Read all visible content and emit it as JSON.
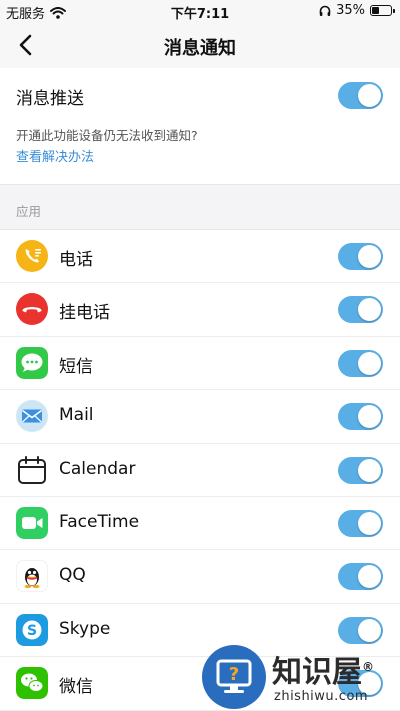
{
  "status_bar": {
    "carrier": "无服务",
    "time": "下午7:11",
    "battery": "35%",
    "battery_level": 0.35,
    "icons": [
      "wifi-icon",
      "headphones-icon",
      "battery-icon"
    ]
  },
  "nav": {
    "title": "消息通知",
    "back_icon": "chevron-left-icon"
  },
  "push": {
    "label": "消息推送",
    "enabled": true,
    "hint": "开通此功能设备仍无法收到通知?",
    "link": "查看解决办法"
  },
  "apps_section": {
    "header": "应用",
    "items": [
      {
        "label": "电话",
        "icon": "phone-icon",
        "enabled": true
      },
      {
        "label": "挂电话",
        "icon": "hang-up-icon",
        "enabled": true
      },
      {
        "label": "短信",
        "icon": "messages-icon",
        "enabled": true
      },
      {
        "label": "Mail",
        "icon": "mail-icon",
        "enabled": true
      },
      {
        "label": "Calendar",
        "icon": "calendar-icon",
        "enabled": true
      },
      {
        "label": "FaceTime",
        "icon": "facetime-icon",
        "enabled": true
      },
      {
        "label": "QQ",
        "icon": "qq-icon",
        "enabled": true
      },
      {
        "label": "Skype",
        "icon": "skype-icon",
        "enabled": true
      },
      {
        "label": "微信",
        "icon": "wechat-icon",
        "enabled": true
      }
    ]
  },
  "colors": {
    "accent": "#5aaee6",
    "link": "#3a8ed6",
    "background": "#f4f4f6"
  },
  "watermark": {
    "name": "知识屋",
    "registered": "®",
    "domain": "zhishiwu.com",
    "icon": "question-monitor-icon"
  }
}
